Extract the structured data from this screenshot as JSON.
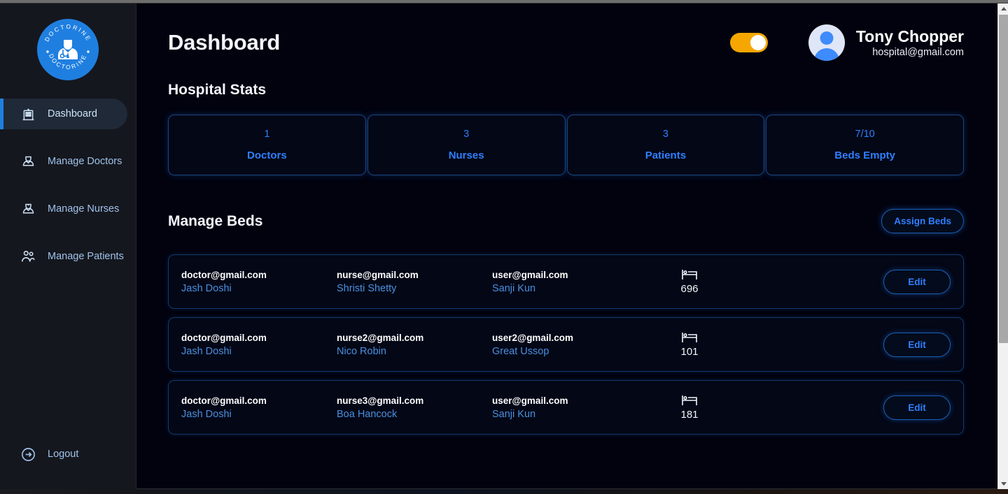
{
  "sidebar": {
    "logo": {
      "icon": "doctor-logo-icon",
      "text_top": "D O C T O R I N E",
      "text_bottom": "D O C T O R I N E"
    },
    "items": [
      {
        "label": "Dashboard",
        "icon": "hospital-icon",
        "active": true
      },
      {
        "label": "Manage Doctors",
        "icon": "doctor-icon",
        "active": false
      },
      {
        "label": "Manage Nurses",
        "icon": "nurse-icon",
        "active": false
      },
      {
        "label": "Manage Patients",
        "icon": "patients-group-icon",
        "active": false
      }
    ],
    "logout": {
      "label": "Logout",
      "icon": "logout-arrow-icon"
    }
  },
  "header": {
    "title": "Dashboard",
    "theme_toggle": {
      "name": "theme-toggle",
      "state": "on",
      "color": "#f5a700"
    },
    "user": {
      "name": "Tony Chopper",
      "email": "hospital@gmail.com",
      "avatar_icon": "user-avatar-icon"
    }
  },
  "stats": {
    "title": "Hospital Stats",
    "cards": [
      {
        "value": "1",
        "label": "Doctors"
      },
      {
        "value": "3",
        "label": "Nurses"
      },
      {
        "value": "3",
        "label": "Patients"
      },
      {
        "value": "7/10",
        "label": "Beds Empty"
      }
    ]
  },
  "beds": {
    "title": "Manage Beds",
    "assign_label": "Assign Beds",
    "edit_label": "Edit",
    "bed_icon": "hospital-bed-icon",
    "rows": [
      {
        "doctor_email": "doctor@gmail.com",
        "doctor_name": "Jash Doshi",
        "nurse_email": "nurse@gmail.com",
        "nurse_name": "Shristi Shetty",
        "patient_email": "user@gmail.com",
        "patient_name": "Sanji Kun",
        "bed_number": "696",
        "edit_label": "Edit"
      },
      {
        "doctor_email": "doctor@gmail.com",
        "doctor_name": "Jash Doshi",
        "nurse_email": "nurse2@gmail.com",
        "nurse_name": "Nico Robin",
        "patient_email": "user2@gmail.com",
        "patient_name": "Great Ussop",
        "bed_number": "101",
        "edit_label": "Edit"
      },
      {
        "doctor_email": "doctor@gmail.com",
        "doctor_name": "Jash Doshi",
        "nurse_email": "nurse3@gmail.com",
        "nurse_name": "Boa Hancock",
        "patient_email": "user@gmail.com",
        "patient_name": "Sanji Kun",
        "bed_number": "181",
        "edit_label": "Edit"
      }
    ]
  },
  "colors": {
    "accent_blue": "#2f7fff",
    "toggle_amber": "#f5a700",
    "sidebar_bg": "#15171e",
    "main_bg": "#01020e",
    "card_border": "#19457f"
  },
  "scrollbar": {
    "name": "vertical-scrollbar"
  }
}
